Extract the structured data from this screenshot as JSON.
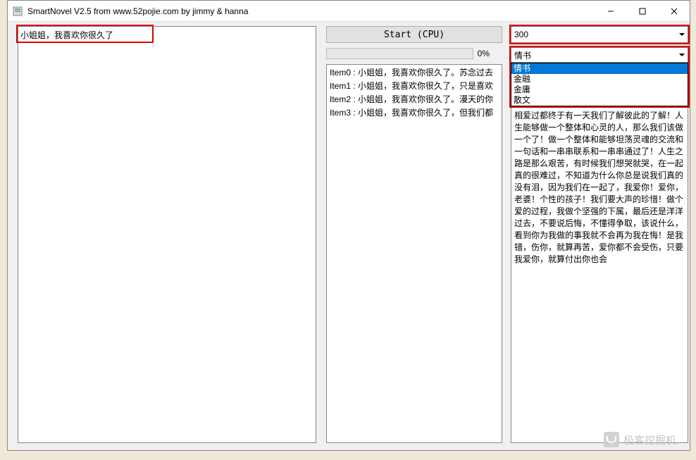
{
  "window": {
    "title": "SmartNovel V2.5  from www.52pojie.com by jimmy & hanna"
  },
  "input": {
    "text": "小姐姐，我喜欢你很久了"
  },
  "start_button": {
    "label": "Start (CPU)"
  },
  "num_combo": {
    "value": "300"
  },
  "progress": {
    "percent_label": "0%"
  },
  "style_combo": {
    "value": "情书",
    "options": [
      "情书",
      "金融",
      "金庸",
      "散文"
    ],
    "selected_index": 0
  },
  "mid_list": {
    "items": [
      "Item0 : 小姐姐，我喜欢你很久了。苏念过去",
      "Item1 : 小姐姐，我喜欢你很久了，只是喜欢",
      "Item2 : 小姐姐，我喜欢你很久了。漫天的你",
      "Item3 : 小姐姐，我喜欢你很久了，但我们都"
    ]
  },
  "right_output": {
    "text": "相爱过都终于有一天我们了解彼此的了解！人生能够做一个整体和心灵的人，那么我们该做一个了！做一个整体和能够坦荡灵魂的交流和一句话和一串串联系和一串串通过了！人生之路是那么艰苦，有时候我们想哭就哭，在一起真的很难过，不知道为什么你总是说我们真的没有泪，因为我们在一起了，我爱你！爱你，老婆！个性的孩子！我们要大声的珍惜！做个爱的过程，我做个坚强的下属，最后还是洋洋过去，不要说后悔，不懂得争取，该说什么，看到你为我做的事我就不会再为我在悔！是我错，伤你，就算再苦，爱你都不会受伤，只要我爱你，就算付出你也会"
  },
  "watermark": {
    "text": "极客挖掘机"
  }
}
